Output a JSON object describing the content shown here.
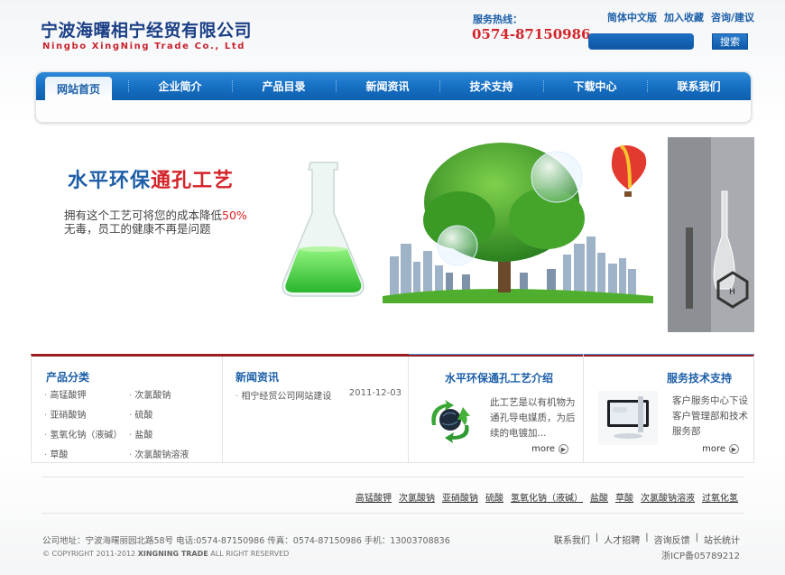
{
  "header": {
    "logo_cn": "宁波海曙相宁经贸有限公司",
    "logo_en": "Ningbo XingNing Trade Co., Ltd",
    "hotline_label": "服务热线：",
    "hotline_number": "0574-87150986",
    "top_links": [
      "简体中文版",
      "加入收藏",
      "咨询/建议"
    ],
    "search_button": "搜索"
  },
  "nav": {
    "items": [
      "网站首页",
      "企业简介",
      "产品目录",
      "新闻资讯",
      "技术支持",
      "下载中心",
      "联系我们"
    ],
    "active_index": 0
  },
  "banner": {
    "title_blue": "水平环保",
    "title_red": "通孔工艺",
    "line1_pre": "拥有这个工艺可将您的成本降低",
    "line1_highlight": "50%",
    "line2": "无毒，员工的健康不再是问题"
  },
  "panels": {
    "products": {
      "title": "产品分类",
      "items": [
        "高锰酸钾",
        "次氯酸钠",
        "亚硝酸钠",
        "硫酸",
        "氢氧化钠（液碱）",
        "盐酸",
        "草酸",
        "次氯酸钠溶液"
      ]
    },
    "news": {
      "title": "新闻资讯",
      "item_title": "相宁经贸公司网站建设",
      "item_date": "2011-12-03"
    },
    "intro": {
      "title": "水平环保通孔工艺介绍",
      "text": "此工艺是以有机物为通孔导电媒质，为后续的电镀加...",
      "more": "more"
    },
    "support": {
      "title": "服务技术支持",
      "text": "客户服务中心下设客户管理部和技术服务部",
      "more": "more"
    }
  },
  "tag_links": [
    "高锰酸钾",
    "次氯酸钠",
    "亚硝酸钠",
    "硫酸",
    "氢氧化钠（液碱）",
    "盐酸",
    "草酸",
    "次氯酸钠溶液",
    "过氧化氢"
  ],
  "footer": {
    "address": "公司地址：宁波海曙丽园北路58号  电话:0574-87150986 传真：0574-87150986 手机：13003708836",
    "copyright_pre": "© COPYRIGHT 2011-2012",
    "copyright_brand": "XINGNING TRADE",
    "copyright_post": "ALL RIGHT RESERVED",
    "links": [
      "联系我们",
      "人才招聘",
      "咨询反馈",
      "站长统计"
    ],
    "icp": "浙ICP备05789212"
  }
}
